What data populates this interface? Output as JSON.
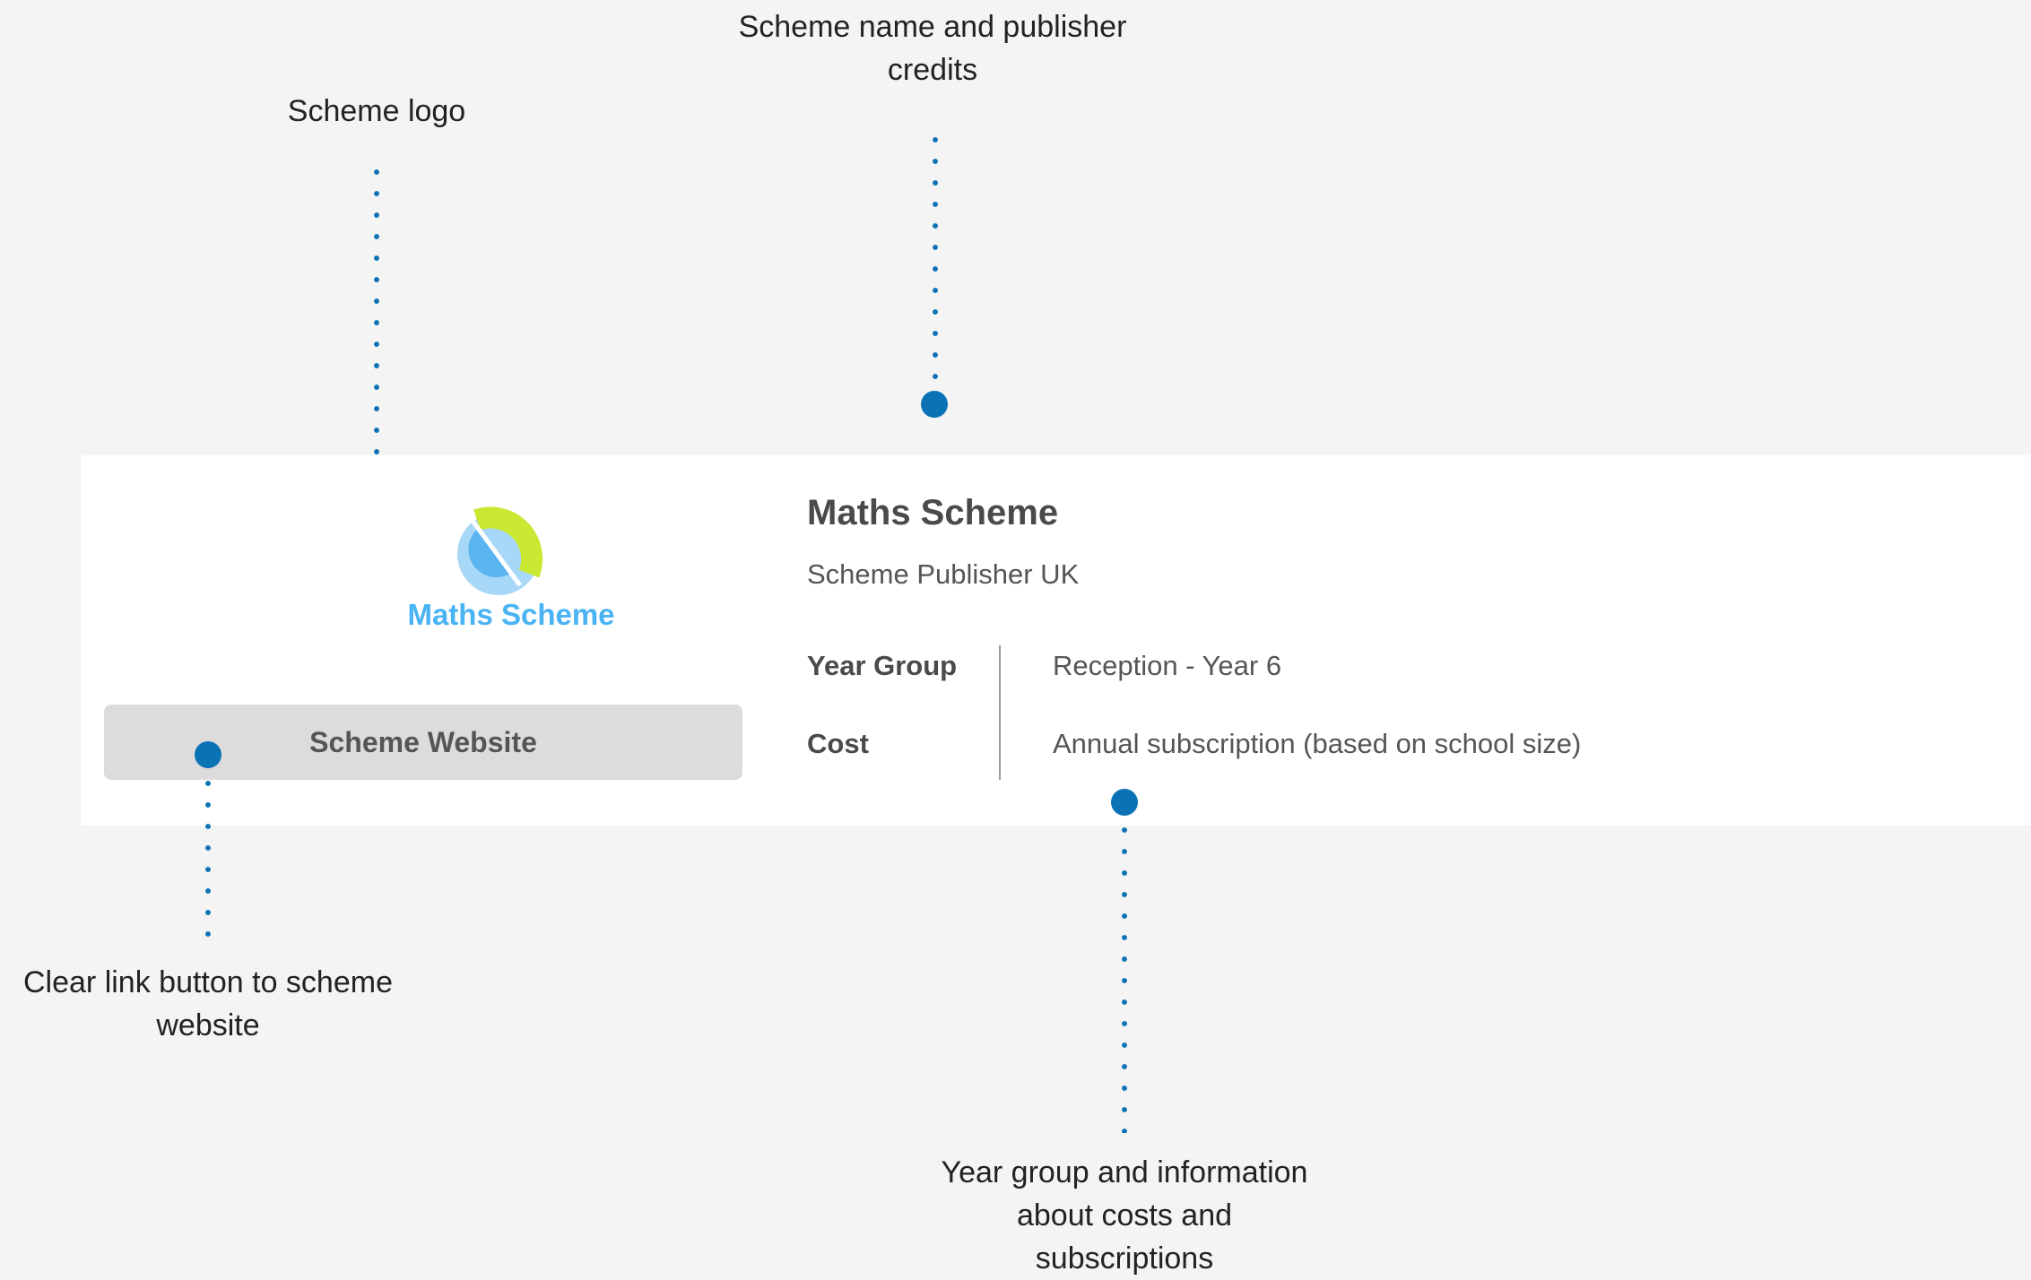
{
  "annotations": {
    "scheme_logo": "Scheme logo",
    "scheme_name_line1": "Scheme name and publisher",
    "scheme_name_line2": "credits",
    "link_button_line1": "Clear link button to scheme",
    "link_button_line2": "website",
    "year_group_line1": "Year group and information",
    "year_group_line2": "about costs and",
    "year_group_line3": "subscriptions"
  },
  "card": {
    "logo_text": "Maths Scheme",
    "website_button": "Scheme Website",
    "title": "Maths Scheme",
    "publisher": "Scheme Publisher UK",
    "rows": [
      {
        "label": "Year Group",
        "value": "Reception - Year 6"
      },
      {
        "label": "Cost",
        "value": "Annual subscription (based on school size)"
      }
    ]
  },
  "colors": {
    "accent_dots": "#0a72b5",
    "logo_lime": "#c8e832",
    "logo_light_blue": "#a8d8f8",
    "logo_blue": "#5ab4f0",
    "logo_text": "#4ab3f4",
    "button_bg": "#dcdcdc",
    "page_bg": "#f4f4f4"
  },
  "icons": {
    "logo": "maths-scheme-logo-icon"
  }
}
